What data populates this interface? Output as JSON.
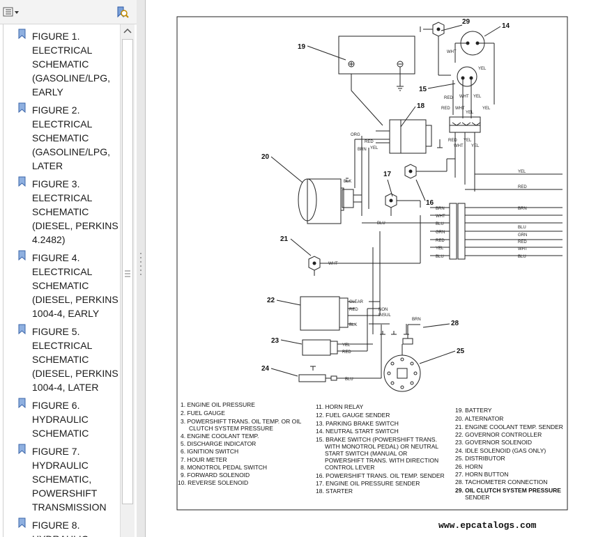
{
  "bookmarks": [
    {
      "lines": [
        "FIGURE 1.",
        "ELECTRICAL",
        "SCHEMATIC",
        "(GASOLINE/LPG,",
        "EARLY"
      ]
    },
    {
      "lines": [
        "FIGURE 2.",
        "ELECTRICAL",
        "SCHEMATIC",
        "(GASOLINE/LPG,",
        "LATER"
      ]
    },
    {
      "lines": [
        "FIGURE 3.",
        "ELECTRICAL",
        "SCHEMATIC",
        "(DIESEL, PERKINS",
        "4.2482)"
      ]
    },
    {
      "lines": [
        "FIGURE 4.",
        "ELECTRICAL",
        "SCHEMATIC",
        "(DIESEL, PERKINS",
        "1004-4, EARLY"
      ]
    },
    {
      "lines": [
        "FIGURE 5.",
        "ELECTRICAL",
        "SCHEMATIC",
        "(DIESEL, PERKINS",
        "1004-4, LATER"
      ]
    },
    {
      "lines": [
        "FIGURE 6.",
        "HYDRAULIC",
        "SCHEMATIC"
      ]
    },
    {
      "lines": [
        "FIGURE 7.",
        "HYDRAULIC",
        "SCHEMATIC,",
        "POWERSHIFT",
        "TRANSMISSION"
      ]
    },
    {
      "lines": [
        "FIGURE 8.",
        "HYDRAULIC"
      ]
    }
  ],
  "callouts": [
    "29",
    "14",
    "19",
    "15",
    "18",
    "20",
    "17",
    "16",
    "21",
    "22",
    "28",
    "23",
    "25",
    "24"
  ],
  "wire_labels": {
    "w_wht14": "WHT",
    "w_yel14": "YEL",
    "w_wht15": "WHT",
    "w_yel15": "YEL",
    "w_red_a": "RED",
    "w_red_b": "RED",
    "w_wht_h1": "WHT",
    "w_yel_h1": "YEL",
    "w_yel_h2": "YEL",
    "w_red_c": "RED",
    "w_wht_c": "WHT",
    "w_yel_c": "YEL",
    "w_orn": "ORG",
    "w_brn18": "BRN",
    "w_red18": "RED",
    "w_yel18": "YEL",
    "w_yel_run": "YEL",
    "w_red_run": "RED",
    "w_blk20": "BLK",
    "w_blu20": "BLU",
    "w_brn_l": "BRN",
    "w_wht_l": "WHT",
    "w_blu_l": "BLU",
    "w_grn_l": "GRN",
    "w_red_l": "RED",
    "w_yel_l": "YEL",
    "w_blu_l2": "BLU",
    "w_brn_r": "BRN",
    "w_blu_r": "BLU",
    "w_grn_r": "GRN",
    "w_red_r": "RED",
    "w_wht_r": "WHT",
    "w_blu_r2": "BLU",
    "w_wht21": "WHT",
    "w_clear": "CLEAR",
    "w_red22": "RED",
    "w_blk22": "BLK",
    "w_non1": "NON",
    "w_non2": "INSUL",
    "w_brn28": "BRN",
    "w_yel23": "YEL",
    "w_red23": "RED",
    "w_blu24": "BLU"
  },
  "legend": {
    "col1": [
      "1. ENGINE OIL PRESSURE",
      "2. FUEL GAUGE",
      "3. POWERSHIFT TRANS. OIL TEMP. OR OIL",
      "CLUTCH SYSTEM PRESSURE",
      "4. ENGINE COOLANT TEMP.",
      "5. DISCHARGE INDICATOR",
      "6. IGNITION SWITCH",
      "7. HOUR METER",
      "8. MONOTROL PEDAL SWITCH",
      "9. FORWARD SOLENOID",
      "10. REVERSE SOLENOID"
    ],
    "col2": [
      "11. HORN RELAY",
      "12. FUEL GAUGE SENDER",
      "13. PARKING BRAKE SWITCH",
      "14. NEUTRAL START SWITCH",
      "15. BRAKE SWITCH (POWERSHIFT TRANS.",
      "WITH MONOTROL PEDAL) OR NEUTRAL",
      "START SWITCH (MANUAL OR",
      "POWERSHIFT TRANS. WITH DIRECTION",
      "CONTROL LEVER",
      "16. POWERSHIFT TRANS. OIL TEMP. SENDER",
      "17. ENGINE OIL PRESSURE SENDER",
      "18. STARTER"
    ],
    "col3": [
      "19. BATTERY",
      "20. ALTERNATOR",
      "21. ENGINE COOLANT TEMP. SENDER",
      "22. GOVERNOR CONTROLLER",
      "23. GOVERNOR SOLENOID",
      "24. IDLE SOLENOID (GAS ONLY)",
      "25. DISTRIBUTOR",
      "26. HORN",
      "27. HORN BUTTON",
      "28. TACHOMETER CONNECTION",
      "29. OIL CLUTCH SYSTEM PRESSURE",
      "SENDER"
    ]
  },
  "watermark": "www.epcatalogs.com",
  "colors": {
    "ink": "#222222",
    "panel": "#f3f3f3",
    "accent": "#4a76c7"
  }
}
